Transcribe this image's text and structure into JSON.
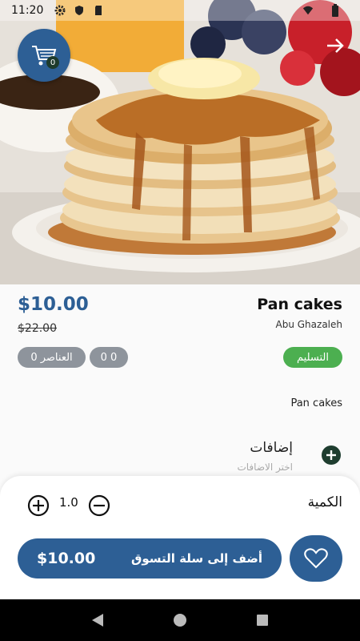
{
  "status_bar": {
    "time": "11:20",
    "icons": [
      "gear-icon",
      "shield-icon",
      "sd-card-icon",
      "wifi-icon",
      "battery-icon"
    ]
  },
  "header": {
    "cart_count": "0",
    "cart_icon": "cart-icon",
    "back_icon": "arrow-right-icon"
  },
  "product": {
    "name": "Pan cakes",
    "vendor": "Abu Ghazaleh",
    "price": "$10.00",
    "old_price": "$22.00",
    "description": "Pan cakes",
    "chips": {
      "items": "0 العناصر",
      "zero": "0 0",
      "delivery": "التسليم"
    }
  },
  "addons": {
    "title": "إضافات",
    "hint": "اختر الاضافات"
  },
  "quantity": {
    "label": "الكمية",
    "value": "1.0"
  },
  "actions": {
    "add_to_cart_label": "أضف إلى سلة التسوق",
    "add_to_cart_price": "$10.00",
    "favorite_icon": "heart-icon"
  },
  "colors": {
    "primary": "#2d5f95",
    "delivery_chip": "#4caf50",
    "muted_chip": "#8e949c",
    "addon_plus": "#1e3d2f"
  }
}
